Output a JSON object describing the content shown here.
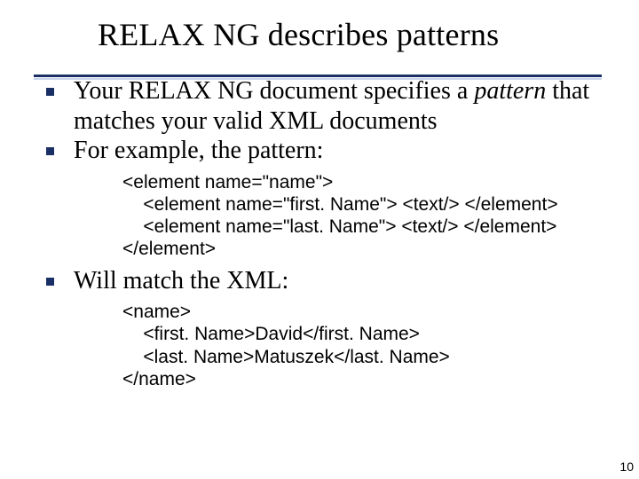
{
  "slide": {
    "title": "RELAX NG describes patterns",
    "page_number": "10"
  },
  "bullets": {
    "b1_pre": "Your RELAX NG document specifies a ",
    "b1_em": "pattern",
    "b1_post": " that matches your valid XML documents",
    "b2": "For example, the pattern:",
    "b3": "Will match the XML:"
  },
  "code1": {
    "l1": "<element name=\"name\">",
    "l2": "    <element name=\"first. Name\"> <text/> </element>",
    "l3": "    <element name=\"last. Name\"> <text/> </element>",
    "l4": "</element>"
  },
  "code2": {
    "l1": "<name>",
    "l2": "    <first. Name>David</first. Name>",
    "l3": "    <last. Name>Matuszek</last. Name>",
    "l4": "</name>"
  }
}
